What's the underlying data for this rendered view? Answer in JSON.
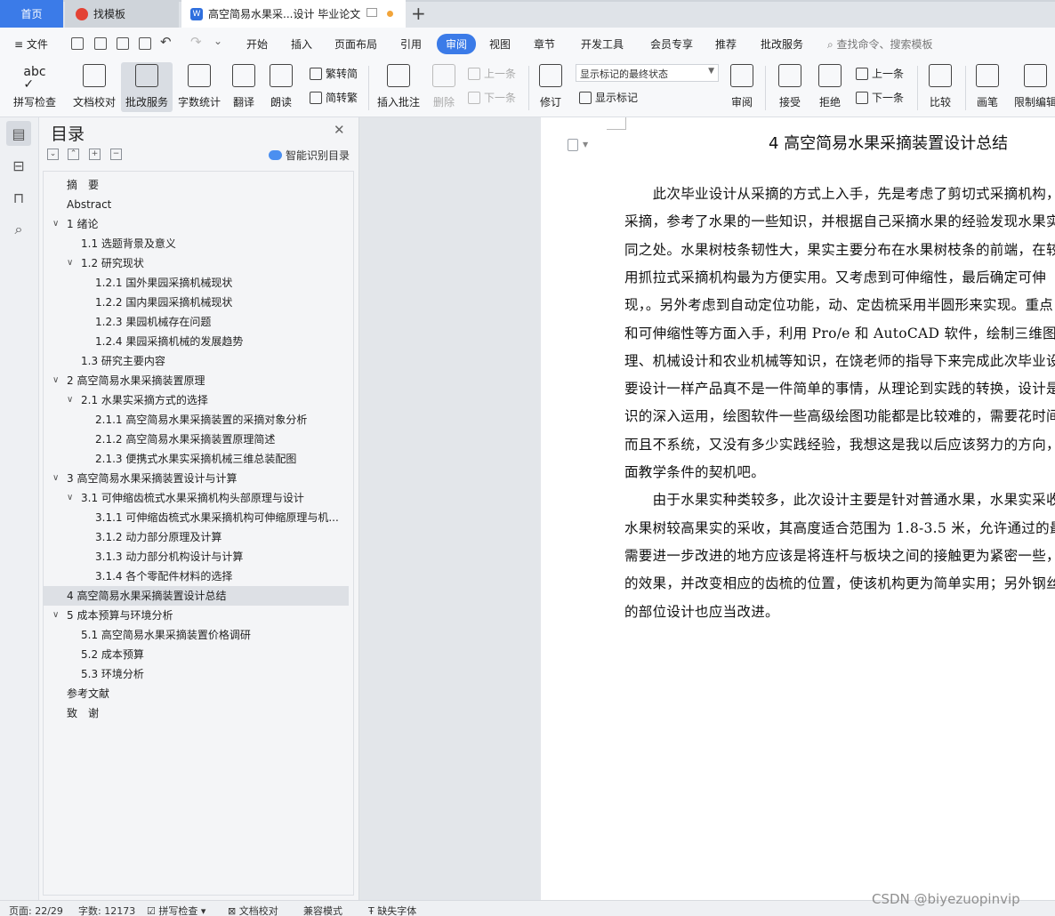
{
  "tabs": {
    "home": "首页",
    "templates": "找模板",
    "document": "高空简易水果采...设计 毕业论文"
  },
  "menu": {
    "file": "文件",
    "items": [
      "开始",
      "插入",
      "页面布局",
      "引用",
      "审阅",
      "视图",
      "章节",
      "开发工具",
      "会员专享",
      "推荐",
      "批改服务"
    ],
    "active": "审阅",
    "search_placeholder": "查找命令、搜索模板"
  },
  "ribbon": {
    "spell_check": "拼写检查",
    "doc_proof": "文档校对",
    "grading_service": "批改服务",
    "word_count": "字数统计",
    "translate": "翻译",
    "read_aloud": "朗读",
    "trad_to_simp": "繁转简",
    "simp_to_trad": "简转繁",
    "insert_comment": "插入批注",
    "delete": "删除",
    "prev_comment": "上一条",
    "next_comment": "下一条",
    "revise": "修订",
    "markup_state": "显示标记的最终状态",
    "show_markup": "显示标记",
    "review": "审阅",
    "accept": "接受",
    "reject": "拒绝",
    "prev_change": "上一条",
    "next_change": "下一条",
    "compare": "比较",
    "ink": "画笔",
    "restrict_edit": "限制编辑"
  },
  "toc": {
    "title": "目录",
    "smart_recognize": "智能识别目录",
    "items": [
      {
        "text": "摘　要",
        "level": 1,
        "chevron": ""
      },
      {
        "text": "Abstract",
        "level": 1,
        "chevron": ""
      },
      {
        "text": "1  绪论",
        "level": 1,
        "chevron": "v"
      },
      {
        "text": "1.1  选题背景及意义",
        "level": 2,
        "chevron": ""
      },
      {
        "text": "1.2 研究现状",
        "level": 2,
        "chevron": "v"
      },
      {
        "text": "1.2.1 国外果园采摘机械现状",
        "level": 3,
        "chevron": ""
      },
      {
        "text": "1.2.2 国内果园采摘机械现状",
        "level": 3,
        "chevron": ""
      },
      {
        "text": "1.2.3 果园机械存在问题",
        "level": 3,
        "chevron": ""
      },
      {
        "text": "1.2.4 果园采摘机械的发展趋势",
        "level": 3,
        "chevron": ""
      },
      {
        "text": "1.3 研究主要内容",
        "level": 2,
        "chevron": ""
      },
      {
        "text": "2  高空简易水果采摘装置原理",
        "level": 1,
        "chevron": "v"
      },
      {
        "text": "2.1    水果实采摘方式的选择",
        "level": 2,
        "chevron": "v"
      },
      {
        "text": "2.1.1 高空简易水果采摘装置的采摘对象分析",
        "level": 3,
        "chevron": ""
      },
      {
        "text": "2.1.2 高空简易水果采摘装置原理简述",
        "level": 3,
        "chevron": ""
      },
      {
        "text": "2.1.3 便携式水果实采摘机械三维总装配图",
        "level": 3,
        "chevron": ""
      },
      {
        "text": "3  高空简易水果采摘装置设计与计算",
        "level": 1,
        "chevron": "v"
      },
      {
        "text": "3.1 可伸缩齿梳式水果采摘机构头部原理与设计",
        "level": 2,
        "chevron": "v"
      },
      {
        "text": "3.1.1 可伸缩齿梳式水果采摘机构可伸缩原理与机...",
        "level": 3,
        "chevron": ""
      },
      {
        "text": "3.1.2 动力部分原理及计算",
        "level": 3,
        "chevron": ""
      },
      {
        "text": "3.1.3 动力部分机构设计与计算",
        "level": 3,
        "chevron": ""
      },
      {
        "text": "3.1.4 各个零配件材料的选择",
        "level": 3,
        "chevron": ""
      },
      {
        "text": "4  高空简易水果采摘装置设计总结",
        "level": 1,
        "chevron": "",
        "selected": true
      },
      {
        "text": "5  成本预算与环境分析",
        "level": 1,
        "chevron": "v"
      },
      {
        "text": "5.1  高空简易水果采摘装置价格调研",
        "level": 2,
        "chevron": ""
      },
      {
        "text": "5.2  成本预算",
        "level": 2,
        "chevron": ""
      },
      {
        "text": "5.3  环境分析",
        "level": 2,
        "chevron": ""
      },
      {
        "text": "参考文献",
        "level": 1,
        "chevron": ""
      },
      {
        "text": "致　谢",
        "level": 1,
        "chevron": ""
      }
    ]
  },
  "document": {
    "heading": "4  高空简易水果采摘装置设计总结",
    "lines": [
      "　　此次毕业设计从采摘的方式上入手，先是考虑了剪切式采摘机构，",
      "采摘，参考了水果的一些知识，并根据自己采摘水果的经验发现水果实",
      "同之处。水果树枝条韧性大，果实主要分布在水果树枝条的前端，在较",
      "用抓拉式采摘机构最为方便实用。又考虑到可伸缩性，最后确定可伸",
      "现，。另外考虑到自动定位功能，动、定齿梳采用半圆形来实现。重点",
      "和可伸缩性等方面入手，利用 Pro/e 和 AutoCAD 软件，绘制三维图及工",
      "理、机械设计和农业机械等知识，在饶老师的指导下来完成此次毕业设",
      "要设计一样产品真不是一件简单的事情，从理论到实践的转换，设计是",
      "识的深入运用，绘图软件一些高级绘图功能都是比较难的，需要花时间",
      "而且不系统，又没有多少实践经验，我想这是我以后应该努力的方向，",
      "面教学条件的契机吧。",
      "　　由于水果实种类较多，此次设计主要是针对普通水果，水果实采收",
      "水果树较高果实的采收，其高度适合范围为 1.8-3.5 米，允许通过的最大",
      "需要进一步改进的地方应该是将连杆与板块之间的接触更为紧密一些，",
      "的效果，并改变相应的齿梳的位置，使该机构更为简单实用；另外钢丝",
      "的部位设计也应当改进。"
    ]
  },
  "status": {
    "page": "页面: 22/29",
    "word_count": "字数: 12173",
    "spell_check": "拼写检查",
    "doc_proof": "文档校对",
    "compat_mode": "兼容模式",
    "missing_font": "缺失字体"
  },
  "watermark": "CSDN @biyezuopinvip"
}
